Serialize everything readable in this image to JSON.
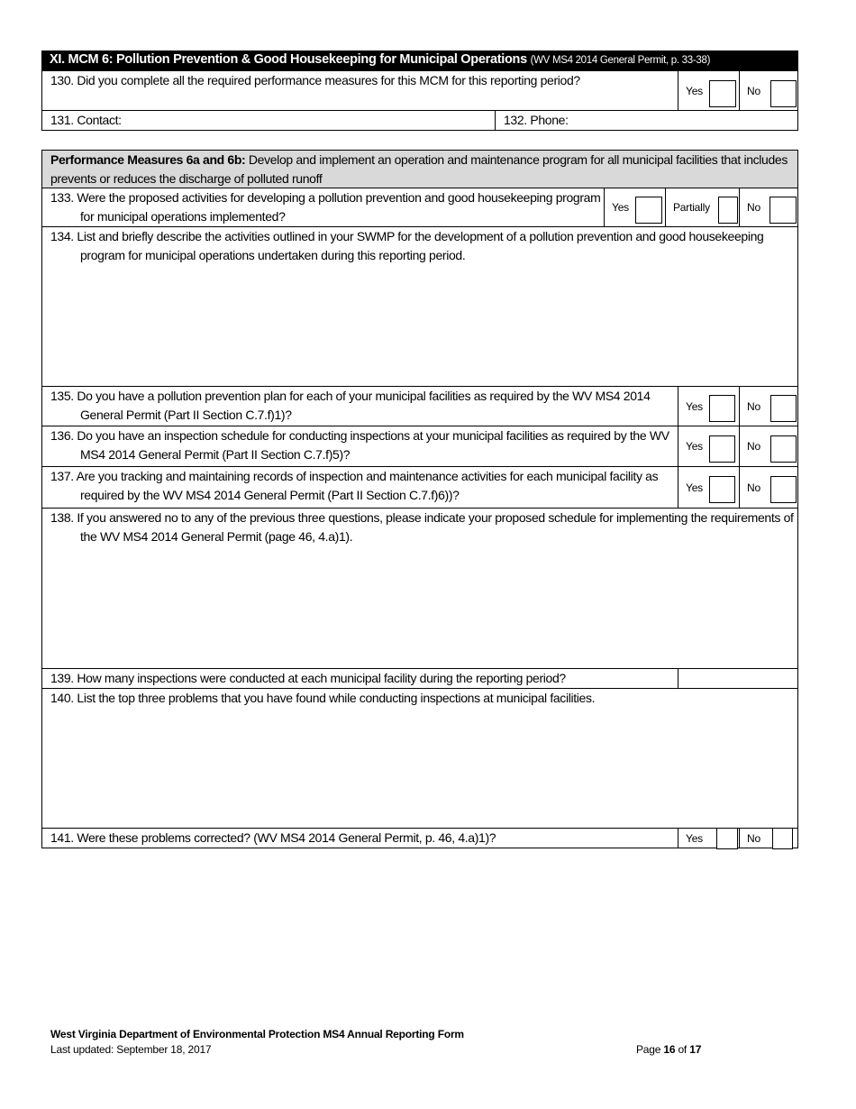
{
  "section": {
    "title": "XI. MCM 6: Pollution Prevention & Good Housekeeping for Municipal Operations",
    "reference": "(WV MS4 2014 General Permit, p. 33-38)"
  },
  "questions": {
    "q130": {
      "text": "130. Did you complete all the required performance measures for this MCM for this reporting period?",
      "yes": "Yes",
      "no": "No"
    },
    "q131": {
      "label": "131. Contact:"
    },
    "q132": {
      "label": "132. Phone:"
    },
    "performance_measures": {
      "title": "Performance Measures 6a and 6b:",
      "text": " Develop and implement an operation and maintenance program for all municipal facilities that includes prevents or reduces the discharge of polluted runoff"
    },
    "q133": {
      "text": "133. Were the proposed activities for developing a pollution prevention and good housekeeping program for municipal operations implemented?",
      "yes": "Yes",
      "partially": "Partially",
      "no": "No"
    },
    "q134": {
      "text": "134. List and briefly describe the activities outlined in your SWMP for the development of a pollution prevention and good housekeeping program for municipal operations undertaken during this reporting period."
    },
    "q135": {
      "text": "135. Do you have a pollution prevention plan for each of your municipal facilities as required by the WV MS4 2014 General Permit (Part II Section C.7.f)1)?",
      "yes": "Yes",
      "no": "No"
    },
    "q136": {
      "text": "136. Do you have an inspection schedule for conducting inspections at your municipal facilities as required by the WV MS4 2014 General Permit (Part II Section C.7.f)5)?",
      "yes": "Yes",
      "no": "No"
    },
    "q137": {
      "text": "137. Are you tracking and maintaining records of inspection and maintenance activities for each municipal facility as required by the WV MS4 2014 General Permit (Part II Section C.7.f)6))?",
      "yes": "Yes",
      "no": "No"
    },
    "q138": {
      "text": "138. If you answered no to any of the previous three questions, please indicate your proposed schedule for implementing the requirements of the WV MS4 2014 General Permit (page 46, 4.a)1)."
    },
    "q139": {
      "text": "139. How many inspections were conducted at each municipal facility during the reporting period?"
    },
    "q140": {
      "text": "140. List the top three problems that you have found while conducting inspections at municipal facilities."
    },
    "q141": {
      "text": "141. Were these problems corrected? (WV MS4 2014 General Permit, p. 46, 4.a)1)?",
      "yes": "Yes",
      "no": "No"
    }
  },
  "footer": {
    "org": "West Virginia Department of Environmental Protection MS4 Annual Reporting Form",
    "updated": "Last updated: September 18, 2017",
    "page_prefix": "Page ",
    "page": "16",
    "page_of": " of ",
    "total": "17"
  }
}
